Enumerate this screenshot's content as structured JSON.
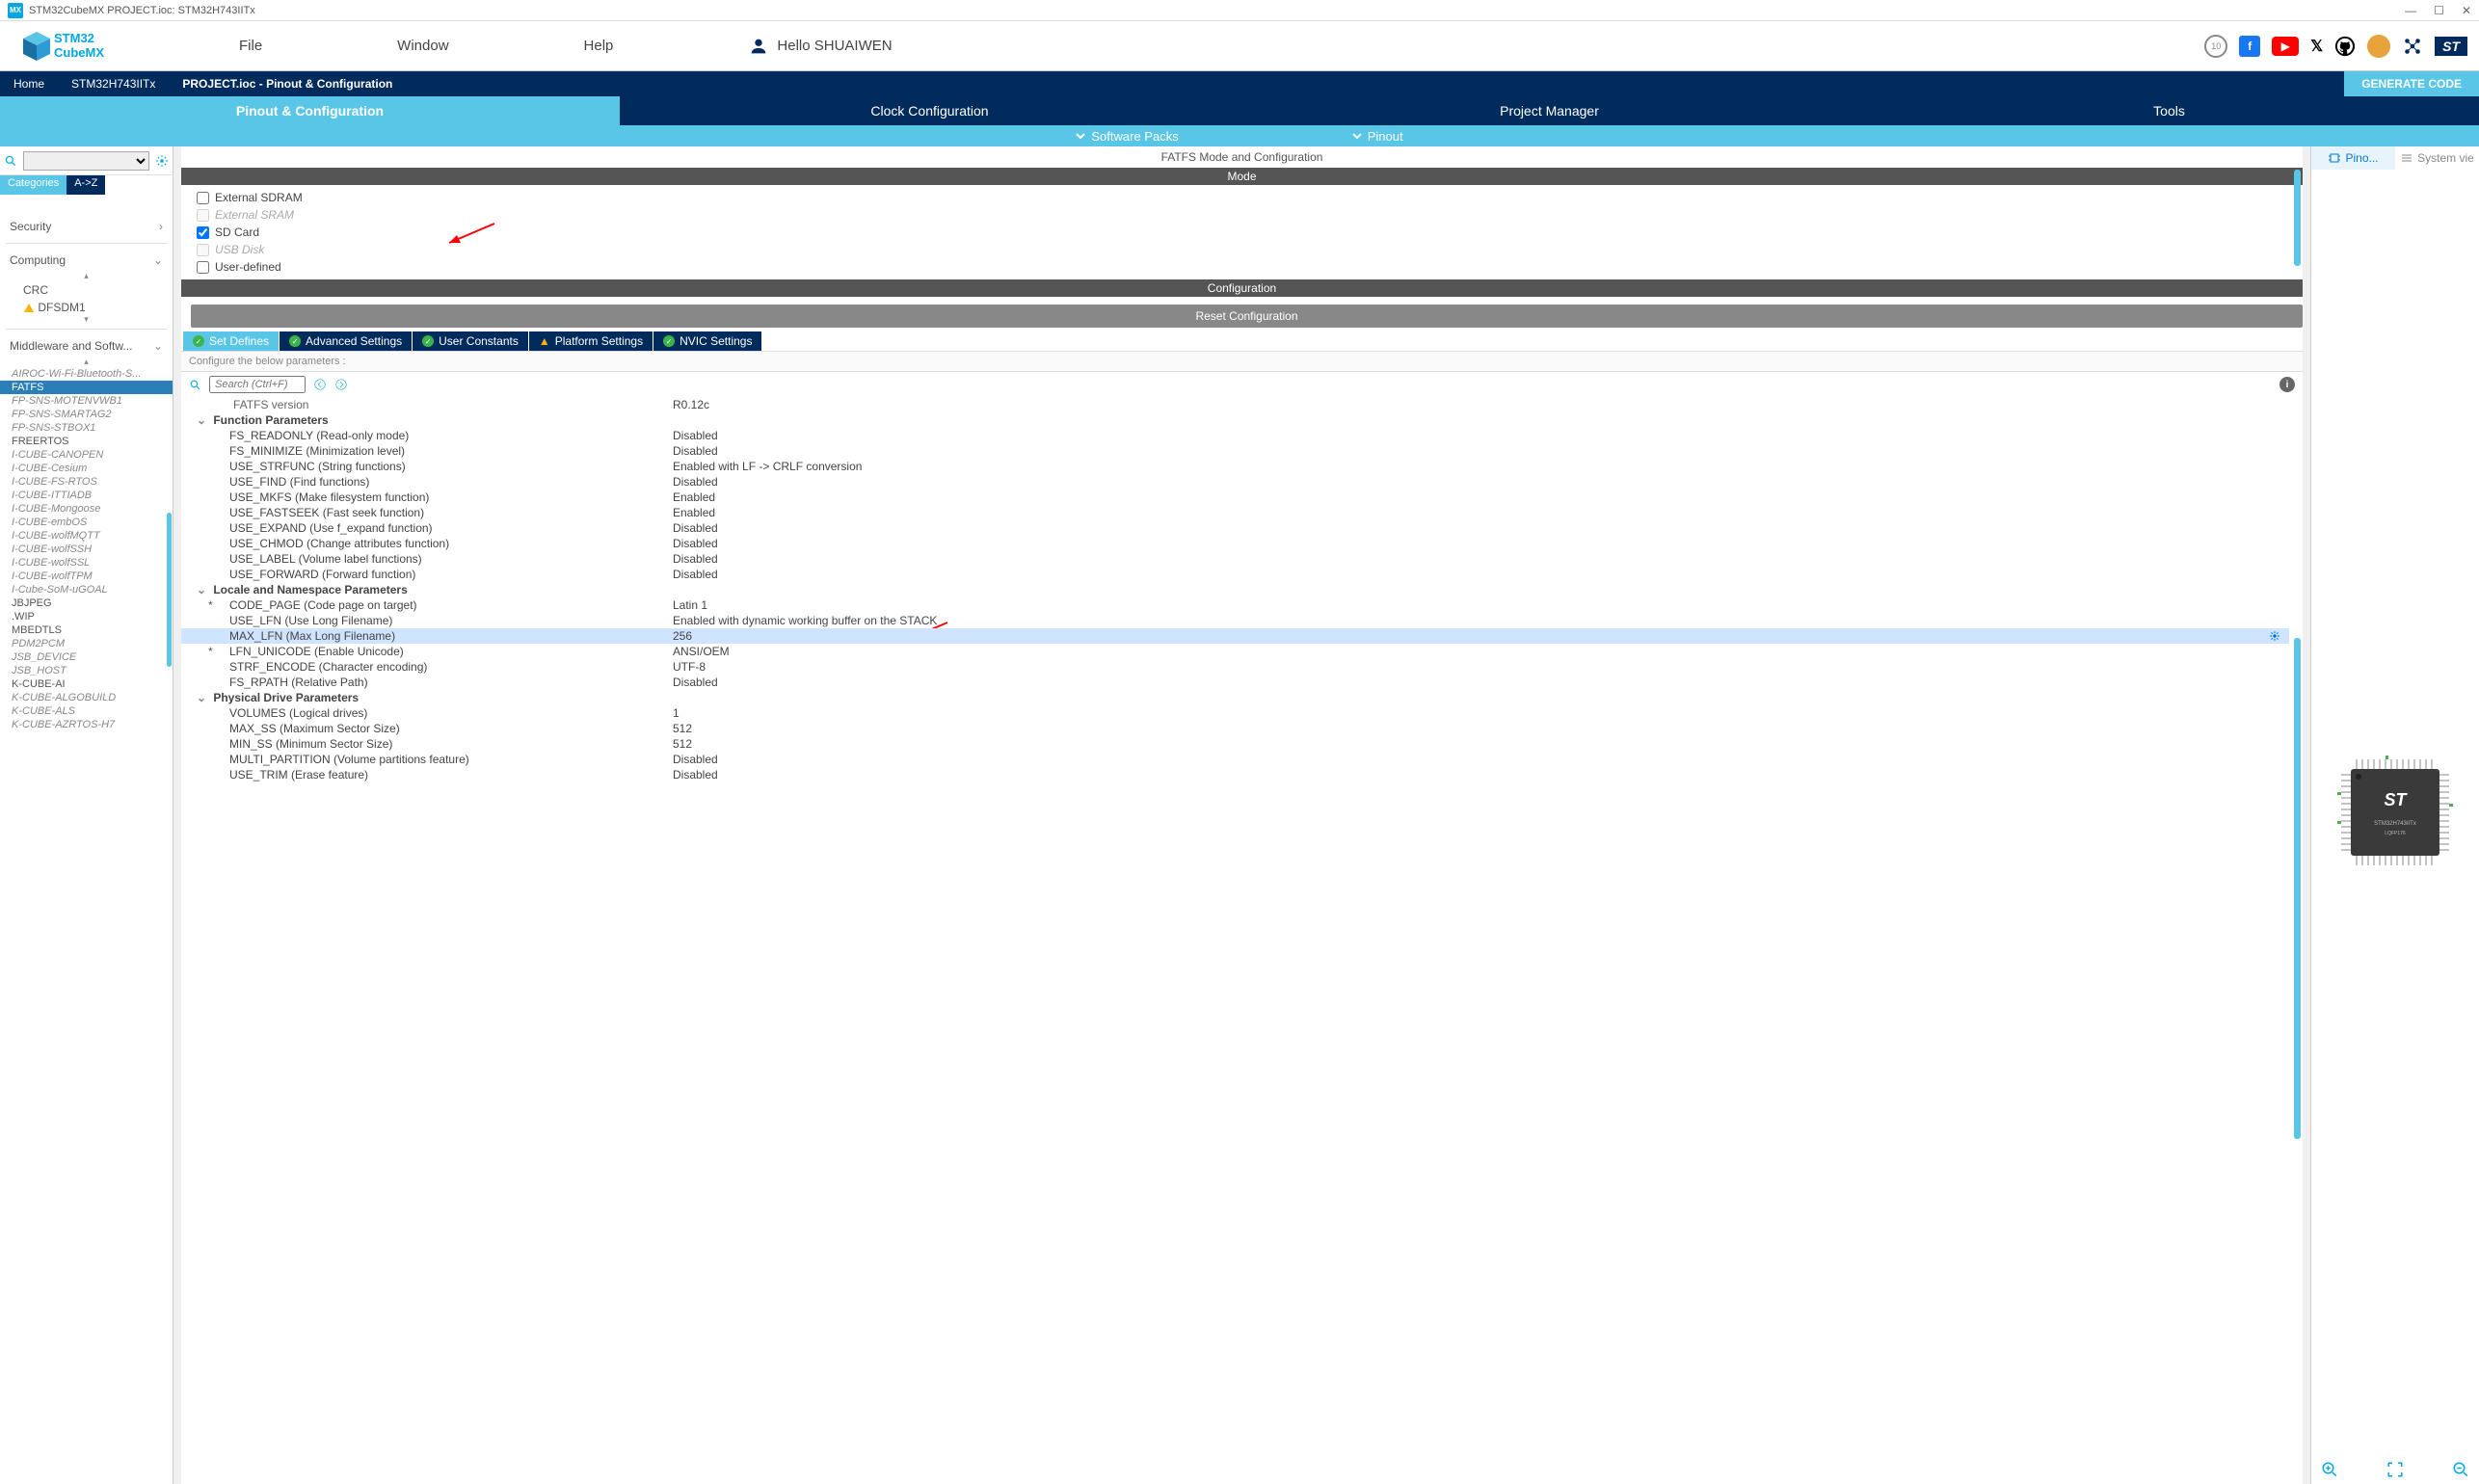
{
  "window": {
    "title": "STM32CubeMX PROJECT.ioc: STM32H743IITx",
    "app_badge": "MX"
  },
  "logo": {
    "line1": "STM32",
    "line2": "CubeMX"
  },
  "menu": {
    "file": "File",
    "window": "Window",
    "help": "Help"
  },
  "user": {
    "prefix": "Hello ",
    "name": "SHUAIWEN"
  },
  "breadcrumb": {
    "home": "Home",
    "chip": "STM32H743IITx",
    "page": "PROJECT.ioc - Pinout & Configuration",
    "generate": "GENERATE CODE"
  },
  "tabs": {
    "pinout": "Pinout & Configuration",
    "clock": "Clock Configuration",
    "project": "Project Manager",
    "tools": "Tools"
  },
  "sub": {
    "packs": "Software Packs",
    "pinout": "Pinout"
  },
  "left": {
    "tab_categories": "Categories",
    "tab_az": "A->Z",
    "cat_security": "Security",
    "cat_computing": "Computing",
    "sub_crc": "CRC",
    "sub_dfsdm": "DFSDM1",
    "cat_middleware": "Middleware and Softw...",
    "items": [
      "AIROC-Wi-Fi-Bluetooth-S...",
      "FATFS",
      "FP-SNS-MOTENVWB1",
      "FP-SNS-SMARTAG2",
      "FP-SNS-STBOX1",
      "FREERTOS",
      "I-CUBE-CANOPEN",
      "I-CUBE-Cesium",
      "I-CUBE-FS-RTOS",
      "I-CUBE-ITTIADB",
      "I-CUBE-Mongoose",
      "I-CUBE-embOS",
      "I-CUBE-wolfMQTT",
      "I-CUBE-wolfSSH",
      "I-CUBE-wolfSSL",
      "I-CUBE-wolfTPM",
      "I-Cube-SoM-uGOAL",
      "JBJPEG",
      ".WIP",
      "MBEDTLS",
      "PDM2PCM",
      "JSB_DEVICE",
      "JSB_HOST",
      "K-CUBE-AI",
      "K-CUBE-ALGOBUILD",
      "K-CUBE-ALS",
      "K-CUBE-AZRTOS-H7"
    ]
  },
  "center": {
    "title": "FATFS Mode and Configuration",
    "mode_header": "Mode",
    "config_header": "Configuration",
    "modes": [
      {
        "label": "External SDRAM",
        "checked": false,
        "disabled": false
      },
      {
        "label": "External SRAM",
        "checked": false,
        "disabled": true
      },
      {
        "label": "SD Card",
        "checked": true,
        "disabled": false
      },
      {
        "label": "USB Disk",
        "checked": false,
        "disabled": true
      },
      {
        "label": "User-defined",
        "checked": false,
        "disabled": false
      }
    ],
    "reset": "Reset Configuration",
    "cfg_tabs": {
      "set_defines": "Set Defines",
      "advanced": "Advanced Settings",
      "user_const": "User Constants",
      "platform": "Platform Settings",
      "nvic": "NVIC Settings"
    },
    "cfg_hint": "Configure the below parameters :",
    "search_placeholder": "Search (Ctrl+F)",
    "params": [
      {
        "type": "head",
        "name": "FATFS version",
        "val": "R0.12c"
      },
      {
        "type": "group",
        "name": "Function Parameters"
      },
      {
        "type": "row",
        "name": "FS_READONLY (Read-only mode)",
        "val": "Disabled"
      },
      {
        "type": "row",
        "name": "FS_MINIMIZE (Minimization level)",
        "val": "Disabled"
      },
      {
        "type": "row",
        "name": "USE_STRFUNC (String functions)",
        "val": "Enabled with LF -> CRLF conversion"
      },
      {
        "type": "row",
        "name": "USE_FIND (Find functions)",
        "val": "Disabled"
      },
      {
        "type": "row",
        "name": "USE_MKFS (Make filesystem function)",
        "val": "Enabled"
      },
      {
        "type": "row",
        "name": "USE_FASTSEEK (Fast seek function)",
        "val": "Enabled"
      },
      {
        "type": "row",
        "name": "USE_EXPAND (Use f_expand function)",
        "val": "Disabled"
      },
      {
        "type": "row",
        "name": "USE_CHMOD (Change attributes function)",
        "val": "Disabled"
      },
      {
        "type": "row",
        "name": "USE_LABEL (Volume label functions)",
        "val": "Disabled"
      },
      {
        "type": "row",
        "name": "USE_FORWARD (Forward function)",
        "val": "Disabled"
      },
      {
        "type": "group",
        "name": "Locale and Namespace Parameters"
      },
      {
        "type": "row",
        "star": true,
        "name": "CODE_PAGE (Code page on target)",
        "val": "Latin 1"
      },
      {
        "type": "row",
        "name": "USE_LFN (Use Long Filename)",
        "val": "Enabled with dynamic working buffer on the STACK"
      },
      {
        "type": "row",
        "selected": true,
        "name": "MAX_LFN (Max Long Filename)",
        "val": "256"
      },
      {
        "type": "row",
        "star": true,
        "name": "LFN_UNICODE (Enable Unicode)",
        "val": "ANSI/OEM"
      },
      {
        "type": "row",
        "name": "STRF_ENCODE (Character encoding)",
        "val": "UTF-8"
      },
      {
        "type": "row",
        "name": "FS_RPATH (Relative Path)",
        "val": "Disabled"
      },
      {
        "type": "group",
        "name": "Physical Drive Parameters"
      },
      {
        "type": "row",
        "name": "VOLUMES (Logical drives)",
        "val": "1"
      },
      {
        "type": "row",
        "name": "MAX_SS (Maximum Sector Size)",
        "val": "512"
      },
      {
        "type": "row",
        "name": "MIN_SS (Minimum Sector Size)",
        "val": "512"
      },
      {
        "type": "row",
        "name": "MULTI_PARTITION (Volume partitions feature)",
        "val": "Disabled"
      },
      {
        "type": "row",
        "name": "USE_TRIM (Erase feature)",
        "val": "Disabled"
      }
    ]
  },
  "right": {
    "tab_pino": "Pino...",
    "tab_sys": "System vie",
    "chip_label": "STM32H743IITx",
    "chip_pkg": "LQFP176"
  }
}
